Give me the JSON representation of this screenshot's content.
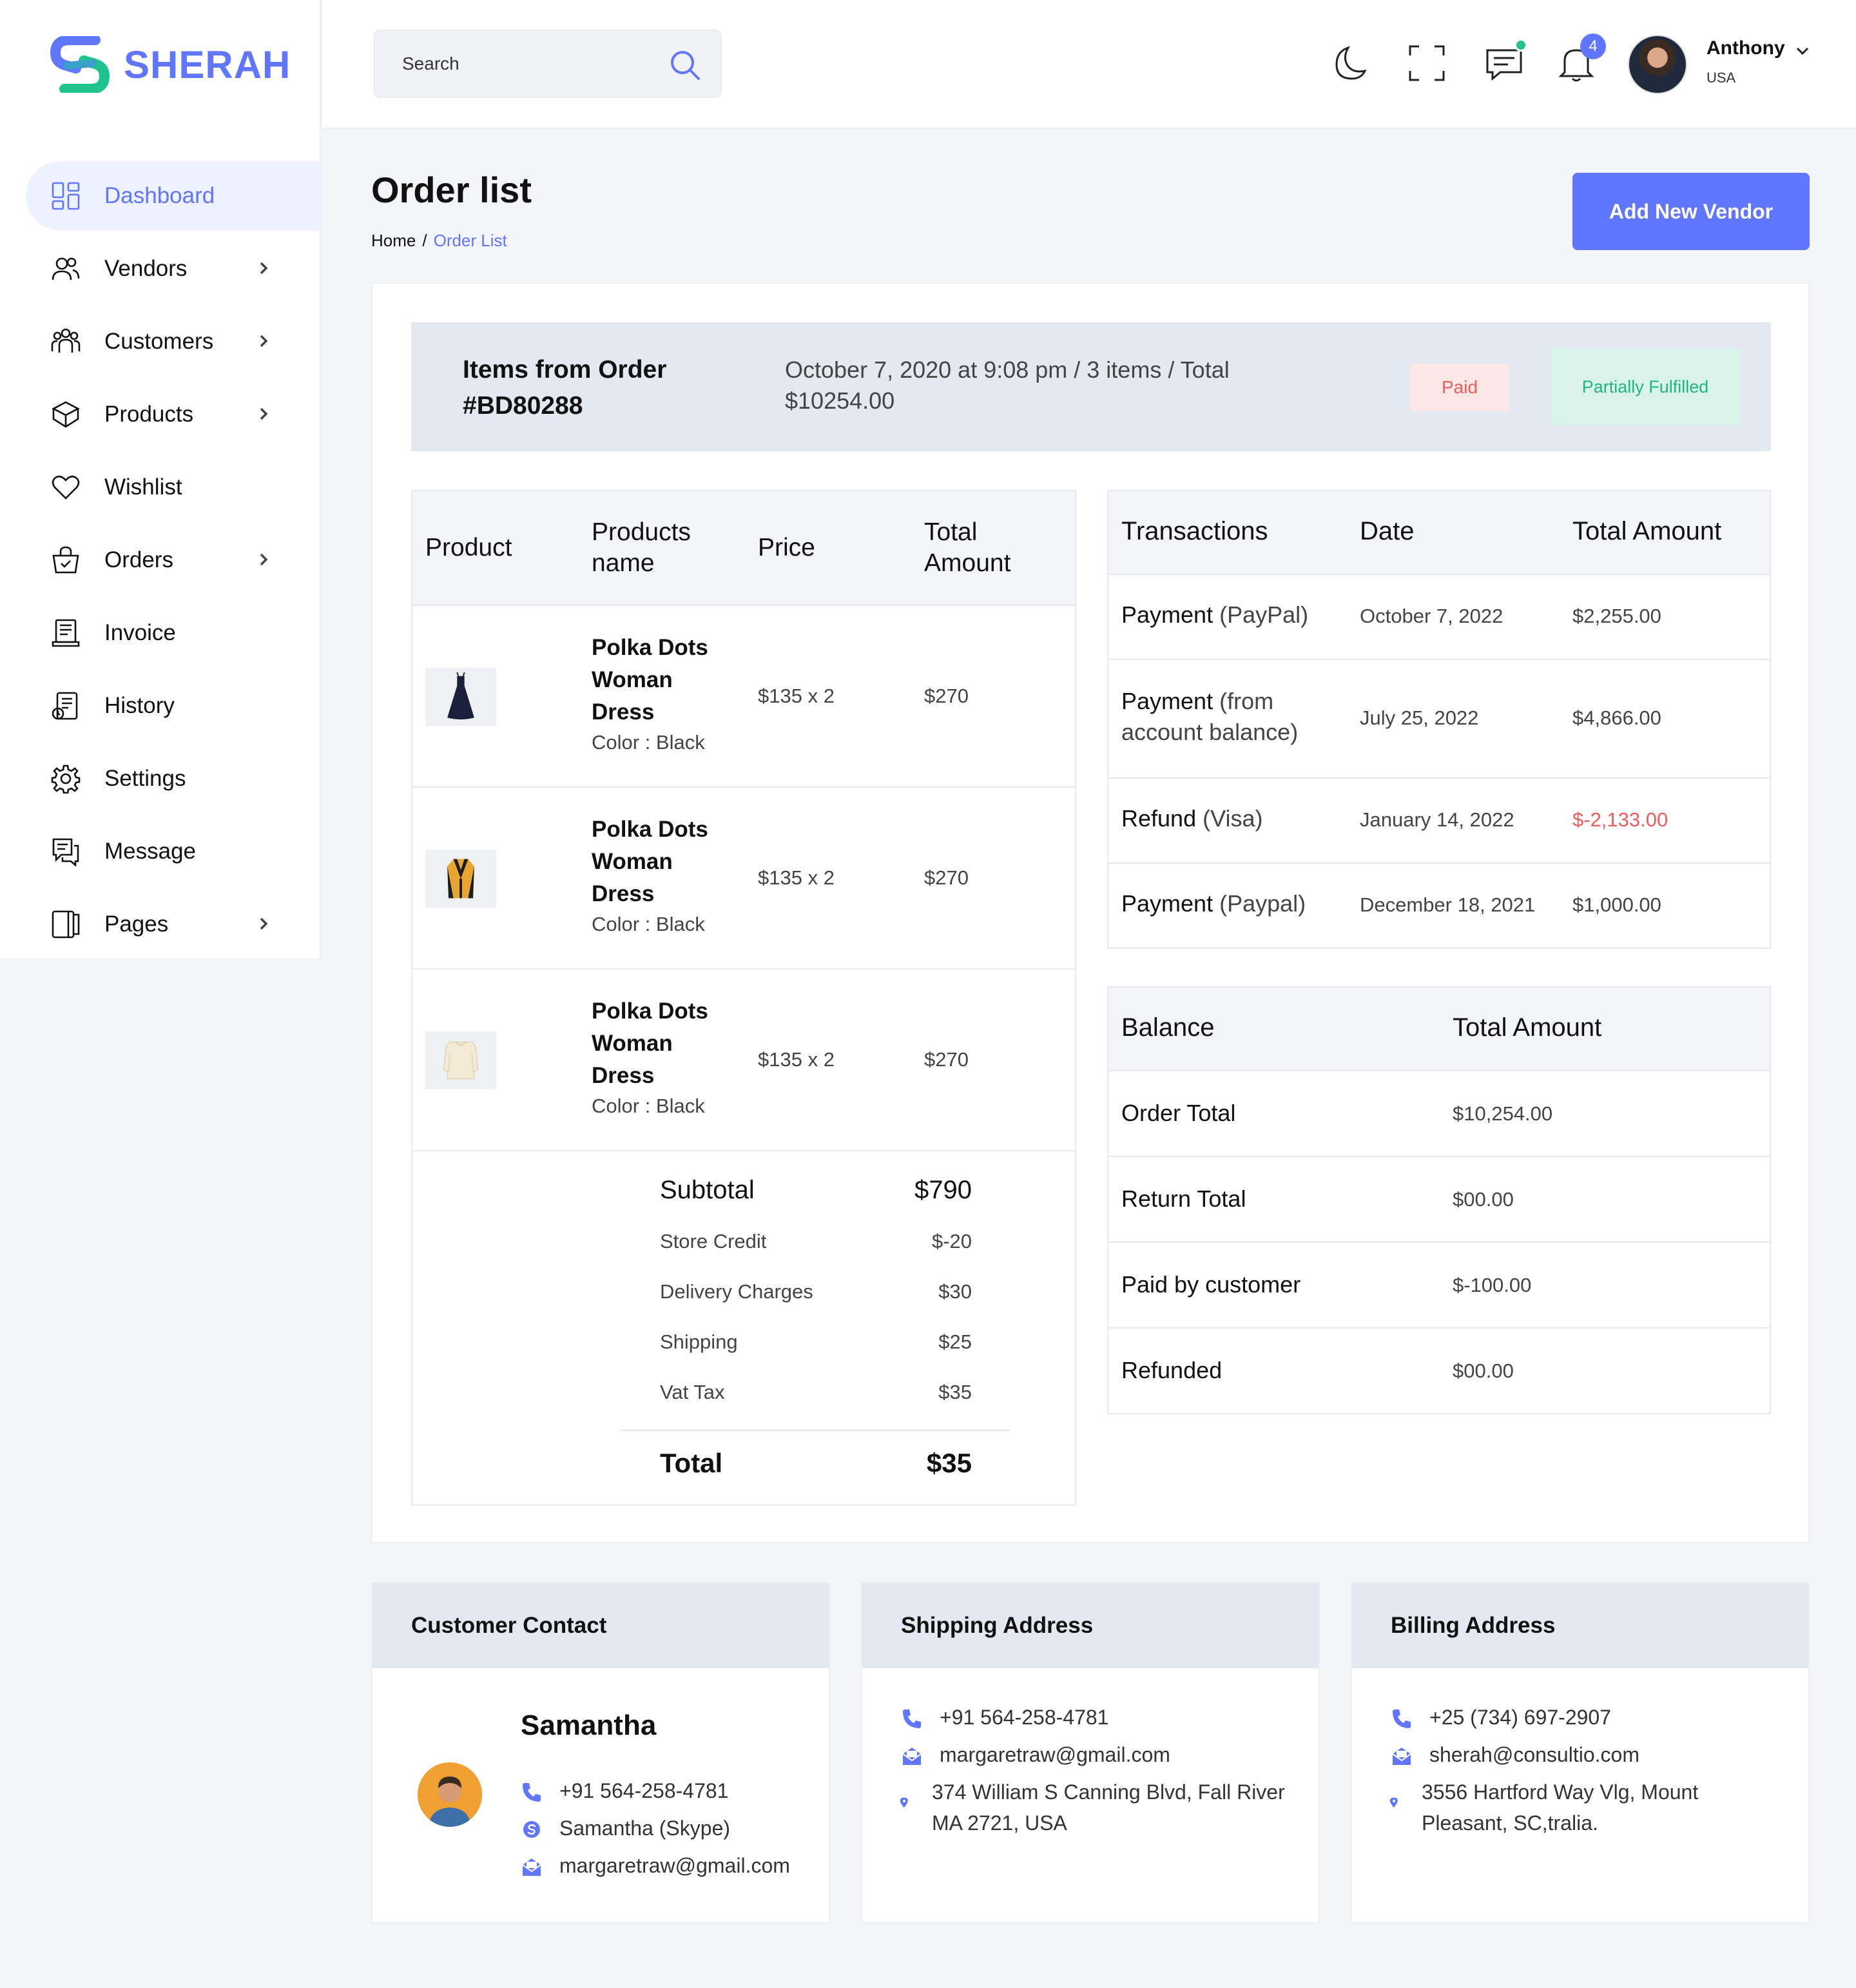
{
  "app": {
    "brand": "SHERAH",
    "brand_color": "#6176fe"
  },
  "sidebar": {
    "items": [
      {
        "label": "Dashboard",
        "icon": "dashboard-icon",
        "active": true,
        "has_submenu": false
      },
      {
        "label": "Vendors",
        "icon": "users-icon",
        "active": false,
        "has_submenu": true
      },
      {
        "label": "Customers",
        "icon": "customers-icon",
        "active": false,
        "has_submenu": true
      },
      {
        "label": "Products",
        "icon": "box-icon",
        "active": false,
        "has_submenu": true
      },
      {
        "label": "Wishlist",
        "icon": "heart-icon",
        "active": false,
        "has_submenu": false
      },
      {
        "label": "Orders",
        "icon": "basket-icon",
        "active": false,
        "has_submenu": true
      },
      {
        "label": "Invoice",
        "icon": "invoice-icon",
        "active": false,
        "has_submenu": false
      },
      {
        "label": "History",
        "icon": "history-icon",
        "active": false,
        "has_submenu": false
      },
      {
        "label": "Settings",
        "icon": "gear-icon",
        "active": false,
        "has_submenu": false
      },
      {
        "label": "Message",
        "icon": "message-icon",
        "active": false,
        "has_submenu": false
      },
      {
        "label": "Pages",
        "icon": "pages-icon",
        "active": false,
        "has_submenu": true
      }
    ]
  },
  "header": {
    "search_placeholder": "Search",
    "notification_count": "4",
    "user": {
      "name": "Anthony",
      "country": "USA"
    }
  },
  "page": {
    "title": "Order list",
    "breadcrumb": {
      "home": "Home",
      "separator": "/",
      "current": "Order List"
    },
    "add_button": "Add New Vendor"
  },
  "order": {
    "title": "Items from Order #BD80288",
    "meta": "October 7, 2020 at 9:08 pm / 3 items / Total $10254.00",
    "status_paid": "Paid",
    "status_fulfilled": "Partially Fulfilled"
  },
  "products": {
    "headers": {
      "product": "Product",
      "name": "Products name",
      "price": "Price",
      "total": "Total Amount"
    },
    "rows": [
      {
        "name": "Polka Dots Woman Dress",
        "color": "Color : Black",
        "price": "$135 x 2",
        "total": "$270",
        "image": "black-dress"
      },
      {
        "name": "Polka Dots Woman Dress",
        "color": "Color : Black",
        "price": "$135 x 2",
        "total": "$270",
        "image": "orange-jacket"
      },
      {
        "name": "Polka Dots Woman Dress",
        "color": "Color : Black",
        "price": "$135 x 2",
        "total": "$270",
        "image": "cream-top"
      }
    ],
    "summary": {
      "subtotal_label": "Subtotal",
      "subtotal": "$790",
      "credit_label": "Store Credit",
      "credit": "$-20",
      "delivery_label": "Delivery Charges",
      "delivery": "$30",
      "shipping_label": "Shipping",
      "shipping": "$25",
      "vat_label": "Vat Tax",
      "vat": "$35",
      "total_label": "Total",
      "total": "$35"
    }
  },
  "transactions": {
    "headers": {
      "type": "Transactions",
      "date": "Date",
      "amount": "Total Amount"
    },
    "rows": [
      {
        "type": "Payment",
        "method": "(PayPal)",
        "date": "October 7, 2022",
        "amount": "$2,255.00"
      },
      {
        "type": "Payment",
        "method": "(from account balance)",
        "date": "July 25, 2022",
        "amount": "$4,866.00"
      },
      {
        "type": "Refund",
        "method": "(Visa)",
        "date": "January 14, 2022",
        "amount": "$-2,133.00"
      },
      {
        "type": "Payment",
        "method": "(Paypal)",
        "date": "December 18, 2021",
        "amount": "$1,000.00"
      }
    ]
  },
  "balance": {
    "headers": {
      "label": "Balance",
      "amount": "Total Amount"
    },
    "rows": [
      {
        "label": "Order Total",
        "amount": "$10,254.00"
      },
      {
        "label": "Return Total",
        "amount": "$00.00"
      },
      {
        "label": "Paid by customer",
        "amount": "$-100.00"
      },
      {
        "label": "Refunded",
        "amount": "$00.00"
      }
    ]
  },
  "customer": {
    "heading": "Customer Contact",
    "name": "Samantha",
    "phone": "+91 564-258-4781",
    "skype": "Samantha (Skype)",
    "email": "margaretraw@gmail.com"
  },
  "shipping": {
    "heading": "Shipping Address",
    "phone": "+91 564-258-4781",
    "email": "margaretraw@gmail.com",
    "address": "374 William S Canning Blvd, Fall River MA 2721, USA"
  },
  "billing": {
    "heading": "Billing Address",
    "phone": "+25 (734) 697-2907",
    "email": "sherah@consultio.com",
    "address": "3556 Hartford Way Vlg, Mount Pleasant, SC,tralia."
  }
}
